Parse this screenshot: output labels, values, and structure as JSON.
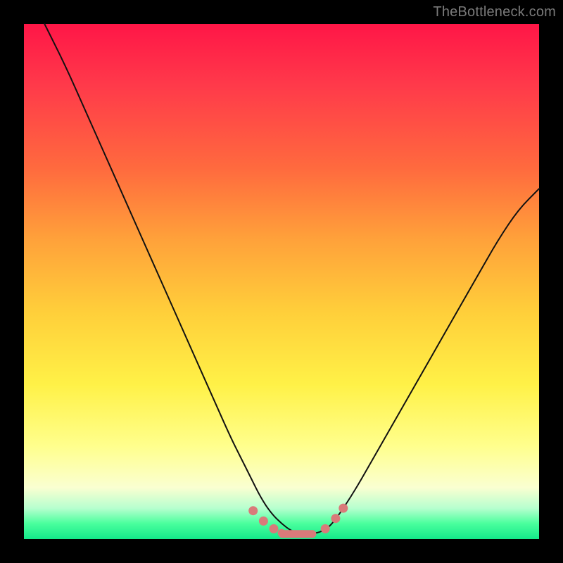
{
  "watermark": "TheBottleneck.com",
  "colors": {
    "frame": "#000000",
    "curve": "#111111",
    "marker": "#d97a7a"
  },
  "chart_data": {
    "type": "line",
    "title": "",
    "xlabel": "",
    "ylabel": "",
    "xlim": [
      0,
      100
    ],
    "ylim": [
      0,
      100
    ],
    "curve": {
      "x": [
        4,
        8,
        12,
        16,
        20,
        24,
        28,
        32,
        36,
        40,
        42,
        44,
        46,
        48,
        50,
        52,
        54,
        56,
        58,
        60,
        64,
        68,
        72,
        76,
        80,
        84,
        88,
        92,
        96,
        100
      ],
      "y": [
        100,
        92,
        83,
        74,
        65,
        56,
        47,
        38,
        29,
        20,
        16,
        12,
        8,
        5,
        3,
        1.5,
        1,
        1,
        1.5,
        3,
        9,
        16,
        23,
        30,
        37,
        44,
        51,
        58,
        64,
        68
      ]
    },
    "markers": [
      {
        "x": 44.5,
        "y": 5.5
      },
      {
        "x": 46.5,
        "y": 3.5
      },
      {
        "x": 48.5,
        "y": 2.0
      },
      {
        "x": 50.0,
        "y": 1.2
      },
      {
        "x": 52.0,
        "y": 1.0
      },
      {
        "x": 54.0,
        "y": 1.0
      },
      {
        "x": 56.0,
        "y": 1.0
      },
      {
        "x": 58.5,
        "y": 2.0
      },
      {
        "x": 60.5,
        "y": 4.0
      },
      {
        "x": 62.0,
        "y": 6.0
      }
    ]
  }
}
